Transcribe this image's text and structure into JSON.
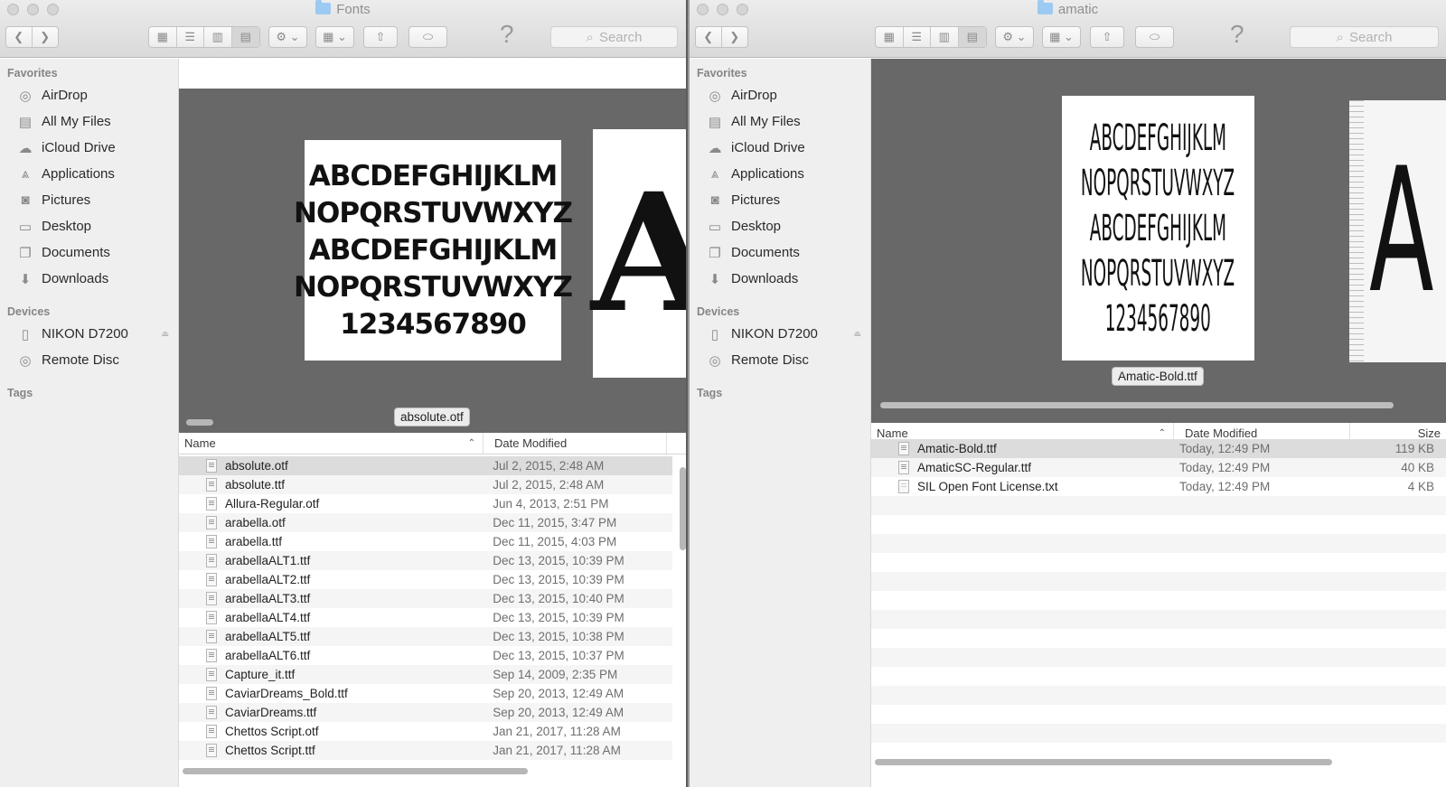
{
  "w1": {
    "title": "Fonts",
    "search_placeholder": "Search",
    "help": "?",
    "sidebar": {
      "favorites_label": "Favorites",
      "favorites": [
        "AirDrop",
        "All My Files",
        "iCloud Drive",
        "Applications",
        "Pictures",
        "Desktop",
        "Documents",
        "Downloads"
      ],
      "devices_label": "Devices",
      "devices": [
        "NIKON D7200",
        "Remote Disc"
      ],
      "tags_label": "Tags"
    },
    "preview": {
      "lines": [
        "ABCDEFGHIJKLM",
        "NOPQRSTUVWXYZ",
        "ABCDEFGHIJKLM",
        "NOPQRSTUVWXYZ",
        "1234567890"
      ],
      "next_glyph": "A",
      "caption": "absolute.otf"
    },
    "columns": {
      "name": "Name",
      "date": "Date Modified"
    },
    "files": [
      {
        "name": "absolute.otf",
        "date": "Jul 2, 2015, 2:48 AM"
      },
      {
        "name": "absolute.ttf",
        "date": "Jul 2, 2015, 2:48 AM"
      },
      {
        "name": "Allura-Regular.otf",
        "date": "Jun 4, 2013, 2:51 PM"
      },
      {
        "name": "arabella.otf",
        "date": "Dec 11, 2015, 3:47 PM"
      },
      {
        "name": "arabella.ttf",
        "date": "Dec 11, 2015, 4:03 PM"
      },
      {
        "name": "arabellaALT1.ttf",
        "date": "Dec 13, 2015, 10:39 PM"
      },
      {
        "name": "arabellaALT2.ttf",
        "date": "Dec 13, 2015, 10:39 PM"
      },
      {
        "name": "arabellaALT3.ttf",
        "date": "Dec 13, 2015, 10:40 PM"
      },
      {
        "name": "arabellaALT4.ttf",
        "date": "Dec 13, 2015, 10:39 PM"
      },
      {
        "name": "arabellaALT5.ttf",
        "date": "Dec 13, 2015, 10:38 PM"
      },
      {
        "name": "arabellaALT6.ttf",
        "date": "Dec 13, 2015, 10:37 PM"
      },
      {
        "name": "Capture_it.ttf",
        "date": "Sep 14, 2009, 2:35 PM"
      },
      {
        "name": "CaviarDreams_Bold.ttf",
        "date": "Sep 20, 2013, 12:49 AM"
      },
      {
        "name": "CaviarDreams.ttf",
        "date": "Sep 20, 2013, 12:49 AM"
      },
      {
        "name": "Chettos Script.otf",
        "date": "Jan 21, 2017, 11:28 AM"
      },
      {
        "name": "Chettos Script.ttf",
        "date": "Jan 21, 2017, 11:28 AM"
      }
    ]
  },
  "w2": {
    "title": "amatic",
    "search_placeholder": "Search",
    "help": "?",
    "sidebar": {
      "favorites_label": "Favorites",
      "favorites": [
        "AirDrop",
        "All My Files",
        "iCloud Drive",
        "Applications",
        "Pictures",
        "Desktop",
        "Documents",
        "Downloads"
      ],
      "devices_label": "Devices",
      "devices": [
        "NIKON D7200",
        "Remote Disc"
      ],
      "tags_label": "Tags"
    },
    "preview": {
      "lines": [
        "ABCDEFGHIJKLM",
        "NOPQRSTUVWXYZ",
        "ABCDEFGHIJKLM",
        "NOPQRSTUVWXYZ",
        "1234567890"
      ],
      "next_glyph": "A",
      "caption": "Amatic-Bold.ttf"
    },
    "columns": {
      "name": "Name",
      "date": "Date Modified",
      "size": "Size"
    },
    "files": [
      {
        "name": "Amatic-Bold.ttf",
        "date": "Today, 12:49 PM",
        "size": "119 KB"
      },
      {
        "name": "AmaticSC-Regular.ttf",
        "date": "Today, 12:49 PM",
        "size": "40 KB"
      },
      {
        "name": "SIL Open Font License.txt",
        "date": "Today, 12:49 PM",
        "size": "4 KB"
      }
    ]
  }
}
